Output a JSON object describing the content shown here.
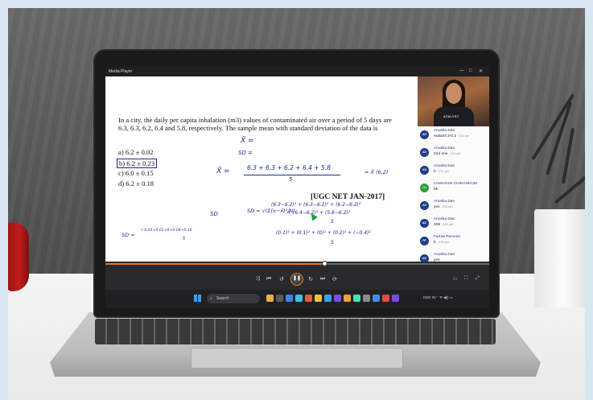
{
  "window": {
    "title": "Media Player",
    "controls": [
      "—",
      "□",
      "✕"
    ]
  },
  "slide": {
    "question": "In a city, the daily per capita inhalation (m3) values of contaminated air over a period of 5 days are 6.3, 6.3, 6.2, 6.4 and 5.8, respectively. The sample mean with standard deviation of the data is",
    "options": [
      "a) 6.2 ± 0.02",
      "b) 6.2 ± 0.23",
      "c) 6.0 ± 0.15",
      "d) 6.2 ± 0.18"
    ],
    "source": "[UGC NET JAN-2017]",
    "handwriting": {
      "xbar_label": "X̄ =",
      "sd_label": "SD =",
      "mean_formula": "6.3 + 6.3 + 6.2 + 6.4 + 5.8",
      "mean_denominator": "5",
      "mean_result": "= X̄ (6.2)",
      "sd_formula": "SD = √(Σ(x−x̄)²/N)",
      "sd_lhs": "SD",
      "sd_expansion_1": "(6.3−6.2)² + (6.3−6.2)² + (6.2−6.2)²",
      "sd_expansion_2": "+ (6.4−6.2)² + (5.8−6.2)²",
      "sd_denom": "5",
      "sd_second_line": "(0.1)² + (0.1)² + (0)² + (0.2)² + (−0.4)²",
      "sd_second_denom": "5",
      "sd_left_lhs": "SD =",
      "sd_left_expr": "√ 0.01+0.01+0+0.04+0.16",
      "sd_left_denom": "5"
    }
  },
  "webcam": {
    "shirt_text": "ATALYST"
  },
  "chat": {
    "messages": [
      {
        "initials": "AD",
        "sender": "Anuska Das",
        "text": "mataml 3-0.2",
        "time": "3:51 pm",
        "color": "#1f3c88"
      },
      {
        "initials": "AD",
        "sender": "Anuska Das",
        "text": "2nd one",
        "time": "3:51 pm",
        "color": "#1f3c88"
      },
      {
        "initials": "AD",
        "sender": "Anuska Das",
        "text": "b",
        "time": "3:51 pm",
        "color": "#1f3c88"
      },
      {
        "initials": "LC",
        "sender": "LAMAYUM CHIRANKUM",
        "text": "bb",
        "time": "",
        "color": "#2e9e3a"
      },
      {
        "initials": "AD",
        "sender": "Anuska Das",
        "text": "yes",
        "time": "3:52 pm",
        "color": "#1f3c88"
      },
      {
        "initials": "AD",
        "sender": "Anuska Das",
        "text": "209",
        "time": "3:52 pm",
        "color": "#1f3c88"
      },
      {
        "initials": "FP",
        "sender": "Farhat Parveen",
        "text": "b",
        "time": "3:52 pm",
        "color": "#1f3c88"
      },
      {
        "initials": "AD",
        "sender": "Anuska Das",
        "text": "yes",
        "time": "",
        "color": "#1f3c88"
      },
      {
        "initials": "AD",
        "sender": "GIASIS",
        "text": "yes",
        "time": "",
        "color": "#3b2a6e"
      }
    ]
  },
  "player": {
    "progress": 0.57,
    "controls": [
      "⤨",
      "⏮",
      "↺",
      "↻",
      "⏭",
      "⟳"
    ],
    "play_state": "pause",
    "play_icon": "❚❚",
    "right_controls": [
      "▭",
      "⛶",
      "⤢"
    ]
  },
  "taskbar": {
    "search_placeholder": "Search",
    "search_icon": "⌕",
    "app_colors": [
      "#e8b04a",
      "#5a5a5a",
      "#3a86e8",
      "#3ac2e8",
      "#e85a3a",
      "#f0c23a",
      "#3a9fe8",
      "#7c4ae8",
      "#e8a23a",
      "#3ae8b2",
      "#8a8a8a",
      "#4a8ae8",
      "#e84a4a",
      "#7a4ae8"
    ],
    "tray_text": "ENG IN",
    "tray_icons": "⌃   ᯤ ◀)) ▭"
  }
}
